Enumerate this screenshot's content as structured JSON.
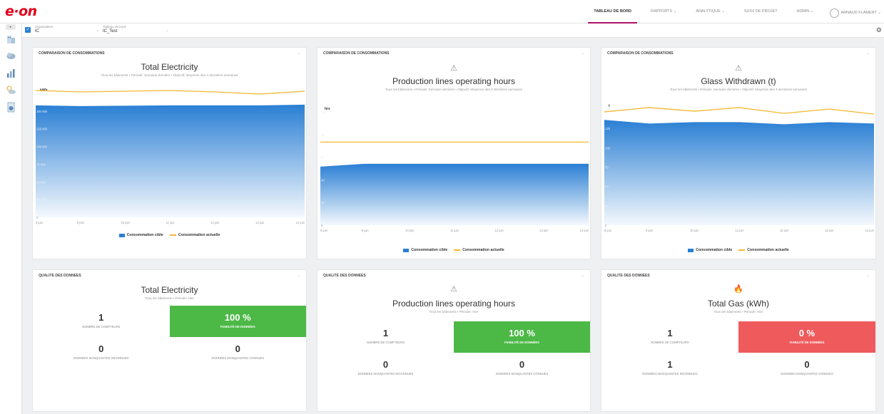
{
  "header": {
    "logo": "e·on",
    "nav": [
      "TABLEAU DE BORD",
      "RAPPORTS",
      "ANALYTIQUE",
      "SUIVI DE PROJET",
      "ADMIN"
    ],
    "nav_carets": [
      "",
      "⌄",
      "⌄",
      "",
      "⌄"
    ],
    "user_name": "ARNAUD FLAMENT ⌄"
  },
  "filters": {
    "organisation_label": "Organisation",
    "organisation_value": "IC",
    "dashboard_label": "Tableau de bord",
    "dashboard_value": "IC_Test"
  },
  "colors": {
    "accent": "#b0136b",
    "target_fill": "#2a7fd4",
    "actual_line": "#f5b730",
    "good": "#4cb846",
    "bad": "#ef5b5c"
  },
  "consumption_panels": [
    {
      "header": "COMPARAISON DE CONSOMMATIONS",
      "icon": "",
      "title": "Total Electricity",
      "subtitle": "Tous les bâtiments  ▪ Période: Semaine dernière  ▪ Objectif: Moyenne des 4 dernières semaines",
      "legend_target": "Consommation cible",
      "legend_actual": "Consommation actuelle"
    },
    {
      "header": "COMPARAISON DE CONSOMMATIONS",
      "icon": "⚠",
      "title": "Production lines operating hours",
      "subtitle": "Tous les bâtiments  ▪ Période: Semaine dernière  ▪ Objectif: Moyenne des 4 dernières semaines",
      "legend_target": "Consommation cible",
      "legend_actual": "Consommation actuelle"
    },
    {
      "header": "COMPARAISON DE CONSOMMATIONS",
      "icon": "⚠",
      "title": "Glass Withdrawn (t)",
      "subtitle": "Tous les bâtiments  ▪ Période: Semaine dernière  ▪ Objectif: Moyenne des 4 dernières semaines",
      "legend_target": "Consommation cible",
      "legend_actual": "Consommation actuelle"
    }
  ],
  "chart_data": [
    {
      "type": "area",
      "unit": "kWh",
      "x": [
        "8 juin",
        "9 juin",
        "10 juin",
        "11 juin",
        "12 juin",
        "13 juin",
        "14 juin"
      ],
      "yticks": [
        "0",
        "25 000",
        "50 000",
        "75 000",
        "100 000",
        "125 000",
        "150 000",
        "175 000"
      ],
      "ylim": [
        0,
        175000
      ],
      "series": [
        {
          "name": "Consommation cible",
          "values": [
            158000,
            157000,
            157500,
            158000,
            158000,
            158000,
            159000
          ]
        },
        {
          "name": "Consommation actuelle",
          "values": [
            179000,
            177000,
            178000,
            179000,
            177000,
            174000,
            178000
          ]
        }
      ]
    },
    {
      "type": "area",
      "unit": "hrs",
      "x": [
        "8 juin",
        "9 juin",
        "10 juin",
        "11 juin",
        "12 juin",
        "13 juin",
        "14 juin"
      ],
      "yticks": [
        "0",
        "20",
        "40",
        "60",
        "80",
        "100"
      ],
      "ylim": [
        0,
        120
      ],
      "series": [
        {
          "name": "Consommation cible",
          "values": [
            62,
            65,
            65,
            65,
            65,
            65,
            65
          ]
        },
        {
          "name": "Consommation actuelle",
          "values": [
            88,
            88,
            88,
            88,
            88,
            88,
            88
          ]
        }
      ]
    },
    {
      "type": "area",
      "unit": "t",
      "x": [
        "8 juin",
        "9 juin",
        "10 juin",
        "11 juin",
        "12 juin",
        "13 juin",
        "14 juin"
      ],
      "yticks": [
        "0",
        "25",
        "50",
        "75",
        "100",
        "125",
        "150"
      ],
      "ylim": [
        0,
        160
      ],
      "series": [
        {
          "name": "Consommation cible",
          "values": [
            145,
            140,
            142,
            142,
            139,
            142,
            140
          ]
        },
        {
          "name": "Consommation actuelle",
          "values": [
            156,
            162,
            157,
            162,
            154,
            160,
            153
          ]
        }
      ]
    }
  ],
  "quality_panels": [
    {
      "header": "QUALITE DES DONNEES",
      "icon": "",
      "title": "Total Electricity",
      "subtitle": "Tous les bâtiments  ▪ Période: Hier",
      "meters_value": "1",
      "meters_label": "NOMBRE DE COMPTEURS",
      "reliability_value": "100 %",
      "reliability_label": "FIABILITÉ DE DONNÉES",
      "missing_unknown_value": "0",
      "missing_unknown_label": "DONNÉES MANQUANTES INCONNUES",
      "missing_known_value": "0",
      "missing_known_label": "DONNÉES MANQUANTES CONNUES",
      "status": "good"
    },
    {
      "header": "QUALITE DES DONNEES",
      "icon": "⚠",
      "title": "Production lines operating hours",
      "subtitle": "Tous les bâtiments  ▪ Période: Hier",
      "meters_value": "1",
      "meters_label": "NOMBRE DE COMPTEURS",
      "reliability_value": "100 %",
      "reliability_label": "FIABILITÉ DE DONNÉES",
      "missing_unknown_value": "0",
      "missing_unknown_label": "DONNÉES MANQUANTES INCONNUES",
      "missing_known_value": "0",
      "missing_known_label": "DONNÉES MANQUANTES CONNUES",
      "status": "good"
    },
    {
      "header": "QUALITE DES DONNEES",
      "icon": "🔥",
      "title": "Total Gas (kWh)",
      "subtitle": "Tous les bâtiments  ▪ Période: Hier",
      "meters_value": "1",
      "meters_label": "NOMBRE DE COMPTEURS",
      "reliability_value": "0 %",
      "reliability_label": "FIABILITÉ DE DONNÉES",
      "missing_unknown_value": "1",
      "missing_unknown_label": "DONNÉES MANQUANTES INCONNUES",
      "missing_known_value": "0",
      "missing_known_label": "DONNÉES MANQUANTES CONNUES",
      "status": "bad"
    }
  ]
}
